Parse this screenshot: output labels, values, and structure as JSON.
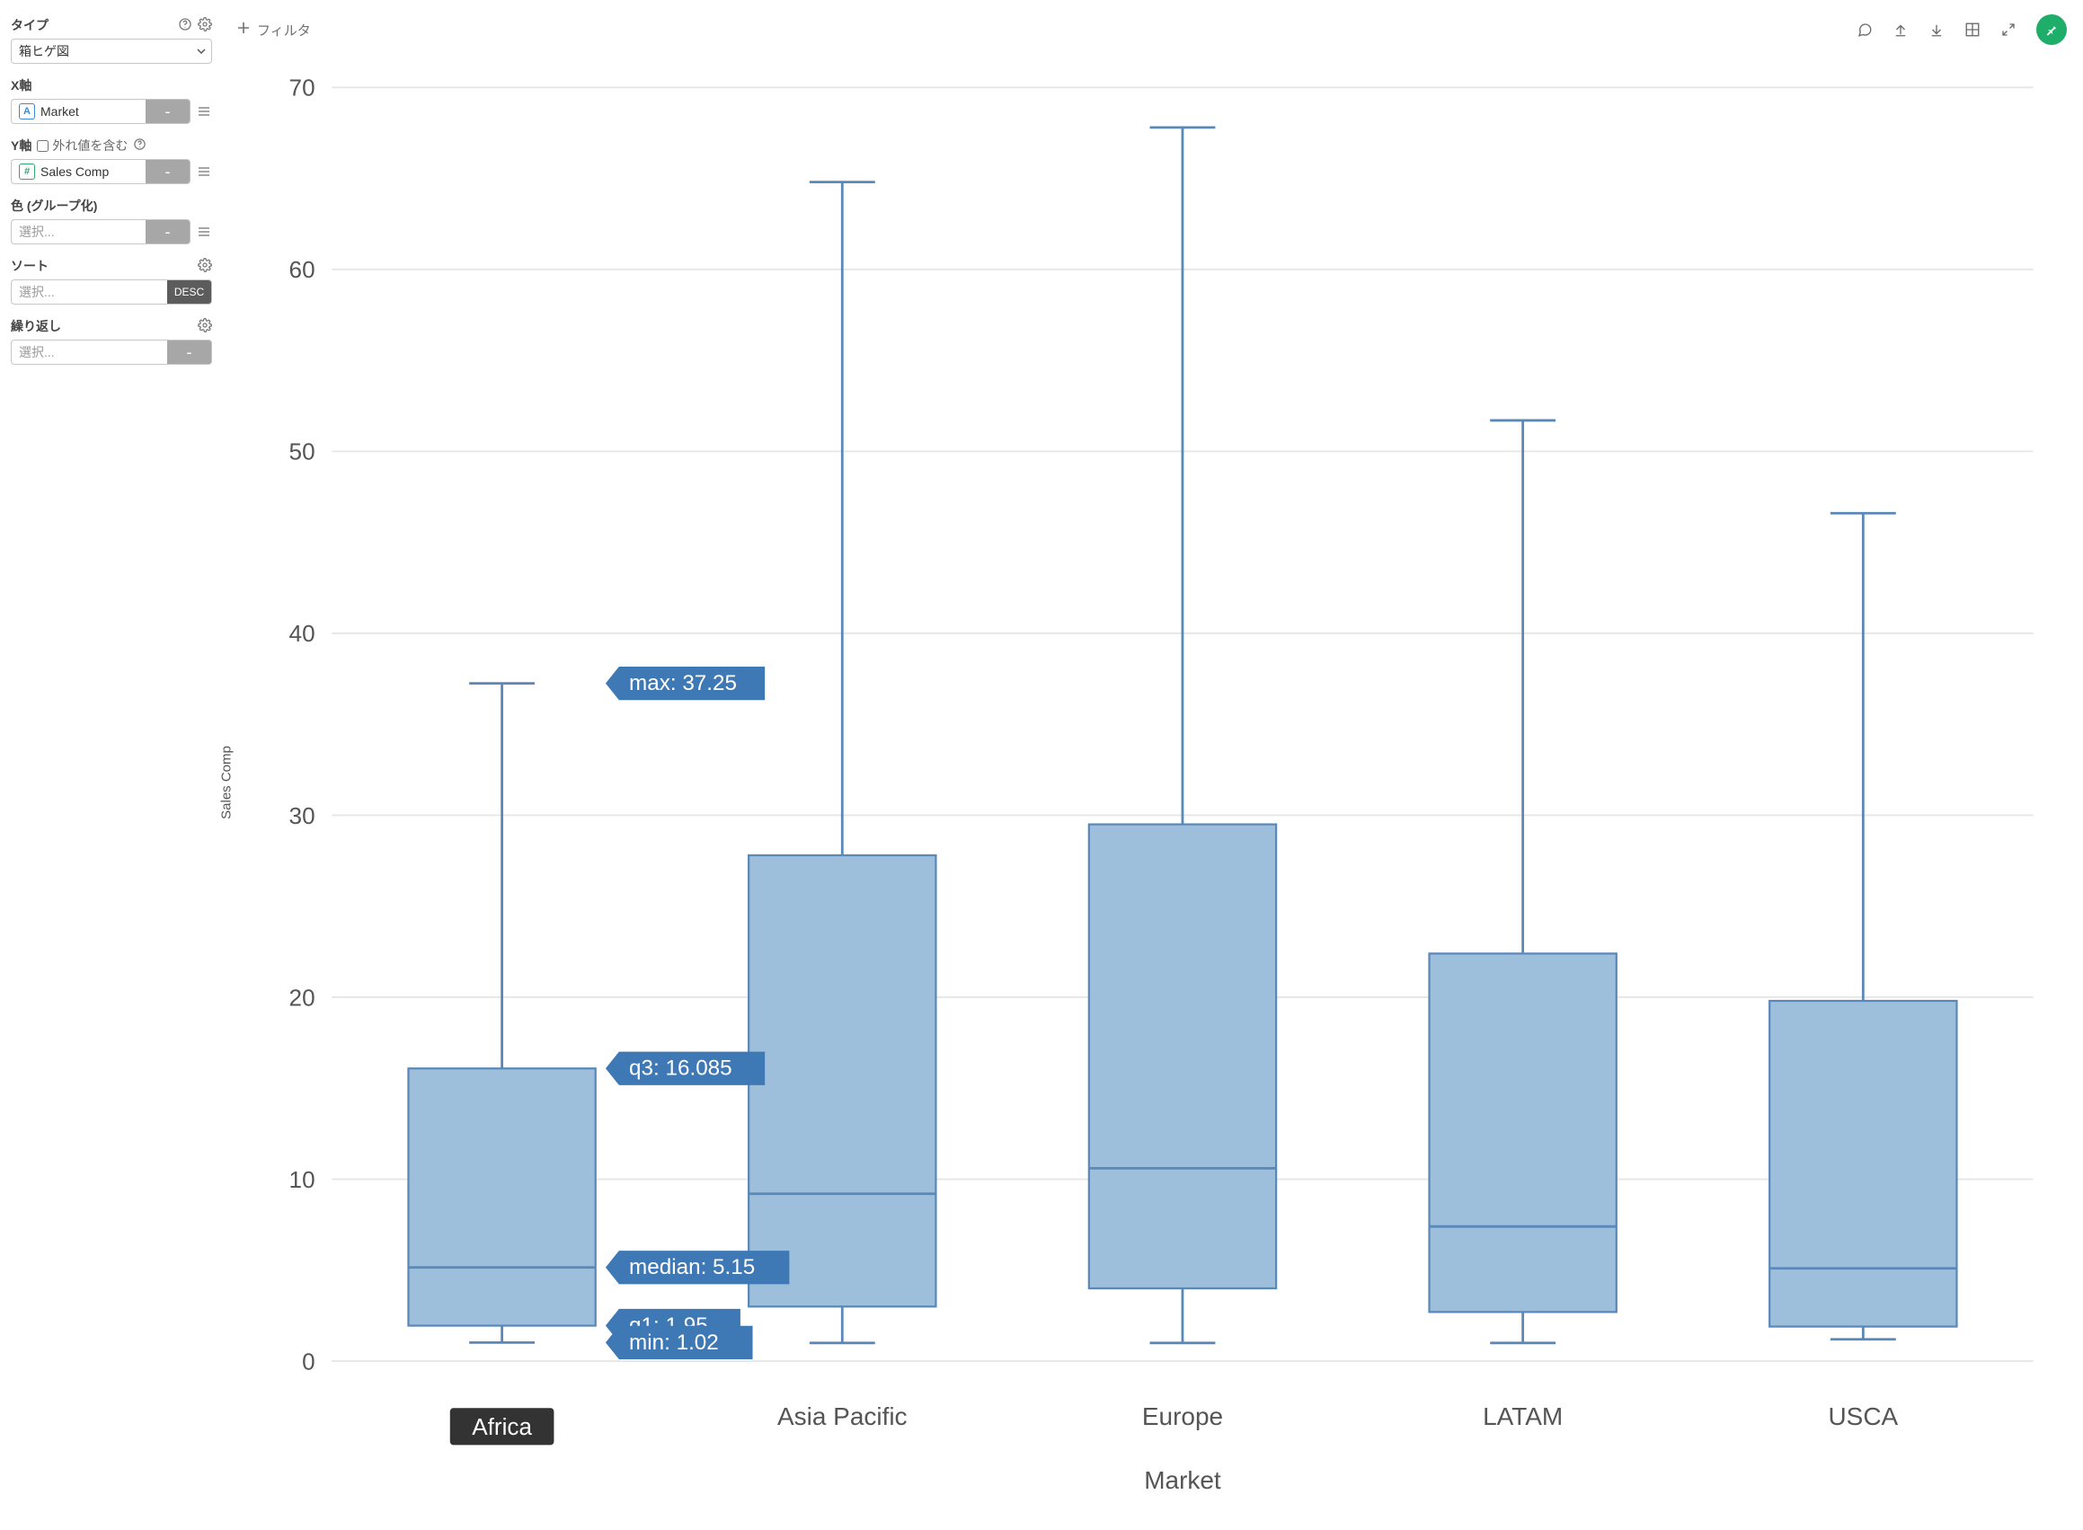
{
  "sidebar": {
    "type_label": "タイプ",
    "type_value": "箱ヒゲ図",
    "x_label": "X軸",
    "x_field": "Market",
    "x_field_icon": "A",
    "y_label": "Y軸",
    "y_outlier_label": "外れ値を含む",
    "y_field": "Sales Comp",
    "y_field_icon": "#",
    "color_label": "色 (グループ化)",
    "color_value": "選択...",
    "sort_label": "ソート",
    "sort_value": "選択...",
    "sort_order": "DESC",
    "repeat_label": "繰り返し",
    "repeat_value": "選択...",
    "dash": "-"
  },
  "top": {
    "filter_label": "フィルタ"
  },
  "chart": {
    "xlabel": "Market",
    "ylabel": "Sales Comp",
    "ylim": [
      0,
      70
    ],
    "yticks": [
      0,
      10,
      20,
      30,
      40,
      50,
      60,
      70
    ],
    "highlighted": "Africa",
    "annotations": {
      "max": "max: 37.25",
      "q3": "q3: 16.085",
      "median": "median: 5.15",
      "q1": "q1: 1.95",
      "min": "min: 1.02"
    }
  },
  "chart_data": {
    "type": "boxplot",
    "title": "",
    "xlabel": "Market",
    "ylabel": "Sales Comp",
    "ylim": [
      0,
      70
    ],
    "categories": [
      "Africa",
      "Asia Pacific",
      "Europe",
      "LATAM",
      "USCA"
    ],
    "series": [
      {
        "name": "Africa",
        "min": 1.02,
        "q1": 1.95,
        "median": 5.15,
        "q3": 16.085,
        "max": 37.25
      },
      {
        "name": "Asia Pacific",
        "min": 1.0,
        "q1": 3.0,
        "median": 9.2,
        "q3": 27.8,
        "max": 64.8
      },
      {
        "name": "Europe",
        "min": 1.0,
        "q1": 4.0,
        "median": 10.6,
        "q3": 29.5,
        "max": 67.8
      },
      {
        "name": "LATAM",
        "min": 1.0,
        "q1": 2.7,
        "median": 7.4,
        "q3": 22.4,
        "max": 51.7
      },
      {
        "name": "USCA",
        "min": 1.2,
        "q1": 1.9,
        "median": 5.1,
        "q3": 19.8,
        "max": 46.6
      }
    ]
  }
}
